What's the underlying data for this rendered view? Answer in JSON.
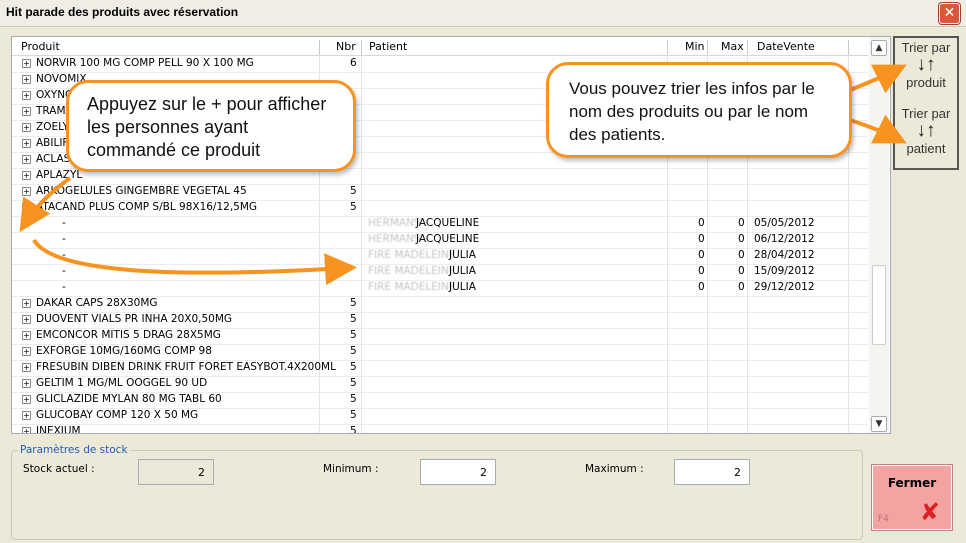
{
  "window": {
    "title": "Hit parade des produits avec réservation",
    "close_glyph": "✕"
  },
  "columns": {
    "produit": "Produit",
    "nbr": "Nbr",
    "patient": "Patient",
    "min": "Min",
    "max": "Max",
    "date": "DateVente"
  },
  "rows": [
    {
      "expand": "+",
      "produit": "NORVIR 100 MG COMP PELL 90 X 100 MG",
      "nbr": "6"
    },
    {
      "expand": "+",
      "produit": "NOVOMIX",
      "nbr": ""
    },
    {
      "expand": "+",
      "produit": "OXYNORM",
      "nbr": ""
    },
    {
      "expand": "+",
      "produit": "TRAMADOL",
      "nbr": ""
    },
    {
      "expand": "+",
      "produit": "ZOELY",
      "nbr": ""
    },
    {
      "expand": "+",
      "produit": "ABILIFY",
      "nbr": ""
    },
    {
      "expand": "+",
      "produit": "ACLASTA",
      "nbr": ""
    },
    {
      "expand": "+",
      "produit": "APLAZYL",
      "nbr": ""
    },
    {
      "expand": "+",
      "produit": "ARKOGELULES GINGEMBRE VEGETAL 45",
      "nbr": "5"
    },
    {
      "expand": "−",
      "produit": "ATACAND PLUS COMP S/BL 98X16/12,5MG",
      "nbr": "5"
    },
    {
      "child": true,
      "produit": "-",
      "patient_blur": "HERMANS",
      "patient": "JACQUELINE",
      "min": "0",
      "max": "0",
      "date": "05/05/2012"
    },
    {
      "child": true,
      "produit": "-",
      "patient_blur": "HERMANS",
      "patient": "JACQUELINE",
      "min": "0",
      "max": "0",
      "date": "06/12/2012"
    },
    {
      "child": true,
      "produit": "-",
      "patient_blur": "FIRE MADELEINE",
      "patient": "JULIA",
      "min": "0",
      "max": "0",
      "date": "28/04/2012"
    },
    {
      "child": true,
      "produit": "-",
      "patient_blur": "FIRE MADELEINE",
      "patient": "JULIA",
      "min": "0",
      "max": "0",
      "date": "15/09/2012"
    },
    {
      "child": true,
      "produit": "-",
      "patient_blur": "FIRE MADELEINE",
      "patient": "JULIA",
      "min": "0",
      "max": "0",
      "date": "29/12/2012"
    },
    {
      "expand": "+",
      "produit": "DAKAR CAPS 28X30MG",
      "nbr": "5"
    },
    {
      "expand": "+",
      "produit": "DUOVENT VIALS PR INHA 20X0,50MG",
      "nbr": "5"
    },
    {
      "expand": "+",
      "produit": "EMCONCOR MITIS 5 DRAG 28X5MG",
      "nbr": "5"
    },
    {
      "expand": "+",
      "produit": "EXFORGE 10MG/160MG COMP 98",
      "nbr": "5"
    },
    {
      "expand": "+",
      "produit": "FRESUBIN DIBEN DRINK FRUIT FORET EASYBOT.4X200ML",
      "nbr": "5"
    },
    {
      "expand": "+",
      "produit": "GELTIM 1 MG/ML OOGGEL 90 UD",
      "nbr": "5"
    },
    {
      "expand": "+",
      "produit": "GLICLAZIDE MYLAN 80 MG TABL 60",
      "nbr": "5"
    },
    {
      "expand": "+",
      "produit": "GLUCOBAY COMP 120 X 50 MG",
      "nbr": "5"
    },
    {
      "expand": "+",
      "produit": "INEXIUM",
      "nbr": "5"
    }
  ],
  "sort": {
    "produit_line1": "Trier par",
    "produit_line2": "produit",
    "patient_line1": "Trier par",
    "patient_line2": "patient",
    "icon": "sort-arrows-icon"
  },
  "callouts": {
    "left": "Appuyez sur le + pour afficher les personnes ayant commandé ce produit",
    "right": "Vous pouvez trier les infos par le nom des produits ou par le nom des patients."
  },
  "stock": {
    "legend": "Paramètres de stock",
    "actuel_label": "Stock actuel :",
    "actuel_value": "2",
    "min_label": "Minimum :",
    "min_value": "2",
    "max_label": "Maximum :",
    "max_value": "2"
  },
  "fermer": {
    "label": "Fermer",
    "key": "F4",
    "icon": "close-x-icon"
  },
  "colors": {
    "accent_orange": "#f7931e",
    "fermer_bg": "#f4a3a3",
    "legend_blue": "#1e5fb5"
  }
}
